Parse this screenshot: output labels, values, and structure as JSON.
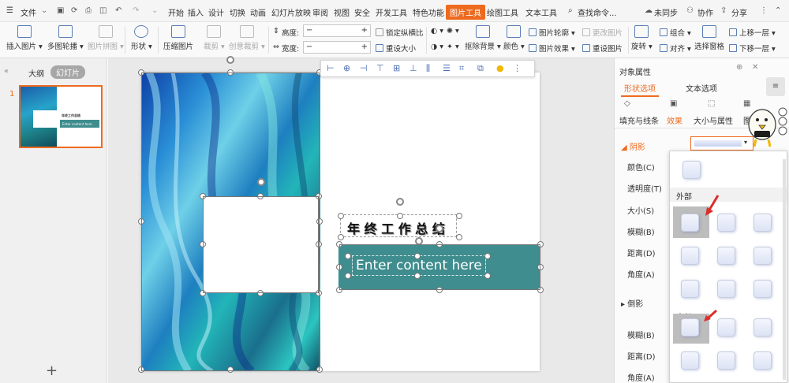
{
  "menubar": {
    "menu": "文件",
    "tabs": [
      "开始",
      "插入",
      "设计",
      "切换",
      "动画",
      "幻灯片放映",
      "审阅",
      "视图",
      "安全",
      "开发工具",
      "特色功能",
      "图片工具",
      "绘图工具",
      "文本工具"
    ],
    "active_tab": "图片工具",
    "search": "查找命令...",
    "sync": "未同步",
    "collab": "协作",
    "share": "分享"
  },
  "ribbon": {
    "insert_picture": "插入图片",
    "multi_picture": "多图轮播",
    "picture_puzzle": "图片拼图",
    "shape": "形状",
    "compress": "压缩图片",
    "crop": "裁剪",
    "creative_crop": "创意裁剪",
    "height_label": "高度:",
    "width_label": "宽度:",
    "lock_ratio": "锁定纵横比",
    "reset_size": "重设大小",
    "remove_bg": "抠除背景",
    "color": "颜色",
    "outline": "图片轮廓",
    "effect": "图片效果",
    "change_pic": "更改图片",
    "reset_pic": "重设图片",
    "rotate": "旋转",
    "group": "组合",
    "align": "对齐",
    "select_pane": "选择窗格",
    "bring_forward": "上移一层",
    "send_backward": "下移一层"
  },
  "leftpane": {
    "tab_outline": "大纲",
    "tab_slides": "幻灯片",
    "slide_number": "1",
    "add": "+"
  },
  "slide": {
    "title": "年 终 工 作 总 结",
    "body": "Enter content here",
    "thumb_title": "年终工作总结",
    "thumb_body": "Enter content here"
  },
  "rpane": {
    "title": "对象属性",
    "tabs": [
      "形状选项",
      "文本选项"
    ],
    "subtabs": [
      "填充与线条",
      "效果",
      "大小与属性",
      "图片"
    ],
    "shadow": "阴影",
    "color": "颜色(C)",
    "transparency": "透明度(T)",
    "size": "大小(S)",
    "blur": "模糊(B)",
    "distance": "距离(D)",
    "angle": "角度(A)",
    "bevel": "倒影",
    "blur2": "模糊(B)",
    "distance2": "距离(D)",
    "angle2": "角度(A)",
    "outer": "外部",
    "inner": "内部"
  },
  "colors": {
    "accent": "#ee6a1f",
    "teal": "#3f8d8e"
  }
}
